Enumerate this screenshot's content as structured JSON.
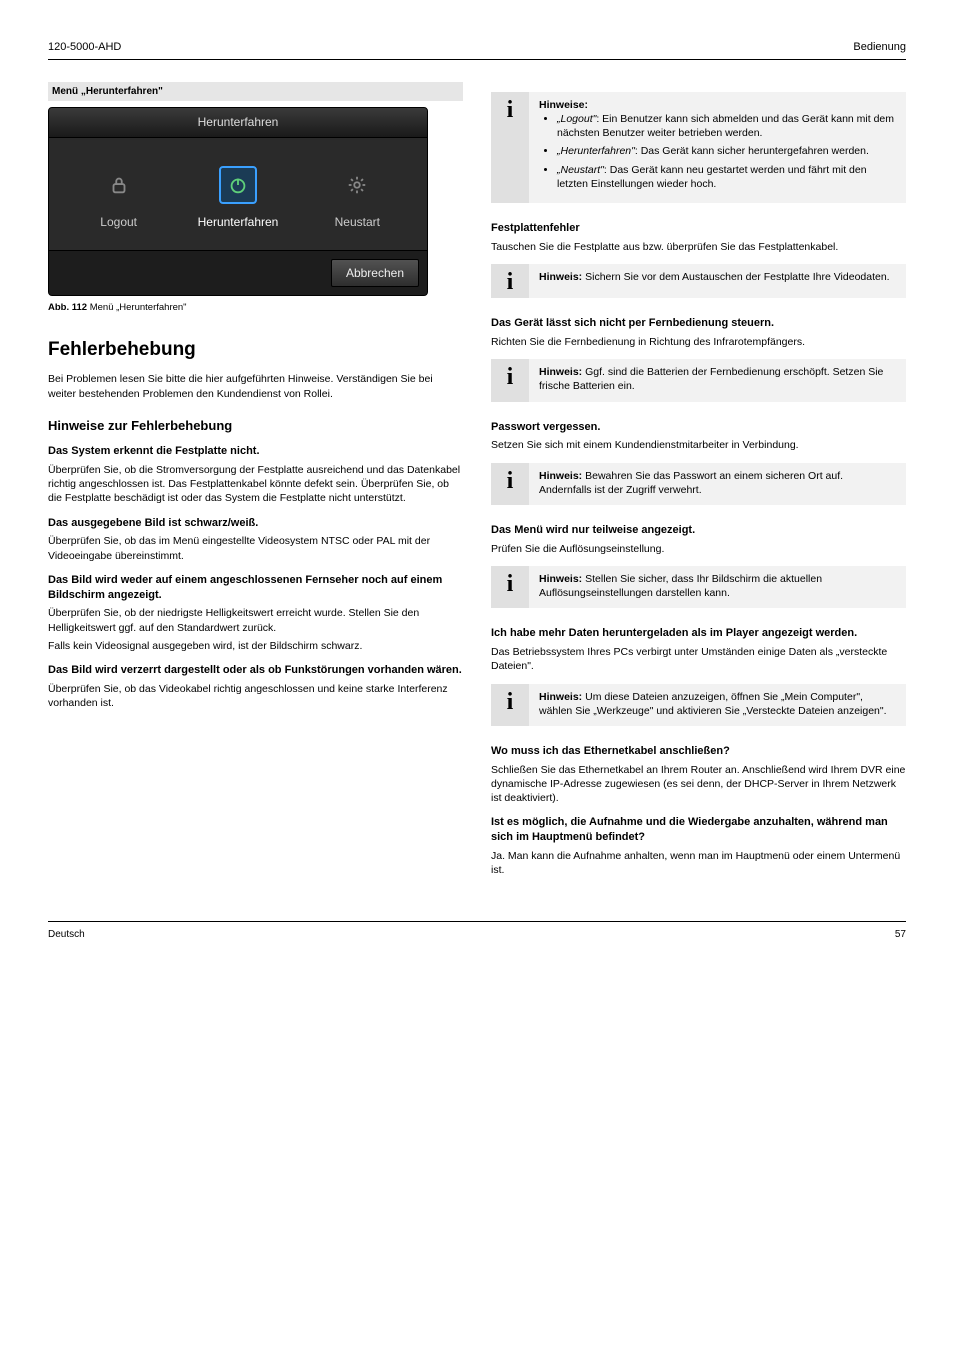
{
  "header": {
    "product": "120-5000-AHD",
    "section_title": "Bedienung"
  },
  "figure": {
    "label_bar": "Menü „Herunterfahren\"",
    "dialog_title": "Herunterfahren",
    "items": {
      "logout": "Logout",
      "shutdown": "Herunterfahren",
      "restart": "Neustart"
    },
    "cancel": "Abbrechen",
    "caption_bold": "Abb. 112",
    "caption_text": " Menü „Herunterfahren\""
  },
  "left": {
    "h1": "Fehlerbehebung",
    "p1": "Bei Problemen lesen Sie bitte die hier aufgeführten Hinweise. Verständigen Sie bei weiter bestehenden Problemen den Kundendienst von Rollei.",
    "h2": "Hinweise zur Fehlerbehebung",
    "q1_h": "Das System erkennt die Festplatte nicht.",
    "q1_p": "Überprüfen Sie, ob die Stromversorgung der Festplatte ausreichend und das Datenkabel richtig angeschlossen ist. Das Festplattenkabel könnte defekt sein. Überprüfen Sie, ob die Festplatte beschädigt ist oder das System die Festplatte nicht unterstützt.",
    "q2_h": "Das ausgegebene Bild ist schwarz/weiß.",
    "q2_p": "Überprüfen Sie, ob das im Menü eingestellte Videosystem NTSC oder PAL mit der Videoeingabe übereinstimmt.",
    "q3_h": "Das Bild wird weder auf einem angeschlossenen Fernseher noch auf einem Bildschirm angezeigt.",
    "q3_p_a": "Überprüfen Sie, ob der niedrigste Helligkeitswert erreicht wurde. Stellen Sie den Helligkeitswert ggf. auf den Standardwert zurück.",
    "q3_p_b": "Falls kein Videosignal ausgegeben wird, ist der Bildschirm schwarz.",
    "q4_h": "Das Bild wird verzerrt dargestellt oder als ob Funkstörungen vorhanden wären.",
    "q4_p": "Überprüfen Sie, ob das Videokabel richtig angeschlossen und keine starke Interferenz vorhanden ist."
  },
  "right": {
    "info_notes_title": "Hinweise:",
    "info_n1_a": "„Logout\"",
    "info_n1_b": ": Ein Benutzer kann sich abmelden und das Gerät kann mit dem nächsten Benutzer weiter betrieben werden.",
    "info_n2_a": "„Herunterfahren\"",
    "info_n2_b": ": Das Gerät kann sicher heruntergefahren werden.",
    "info_n3_a": "„Neustart\"",
    "info_n3_b": ": Das Gerät kann neu gestartet werden und fährt mit den letzten Einstellungen wieder hoch.",
    "q5_h": "Festplattenfehler",
    "q5_p1": "Tauschen Sie die Festplatte aus bzw. überprüfen Sie das Festplattenkabel.",
    "q5_info_title": "Hinweis:",
    "q5_info_body": "Sichern Sie vor dem Austauschen der Festplatte Ihre Videodaten.",
    "q6_h": "Das Gerät lässt sich nicht per Fernbedienung steuern.",
    "q6_p1": "Richten Sie die Fernbedienung in Richtung des Infrarotempfängers.",
    "q6_info_title": "Hinweis:",
    "q6_info_body": "Ggf. sind die Batterien der Fernbedienung erschöpft. Setzen Sie frische Batterien ein.",
    "q7_h": "Passwort vergessen.",
    "q7_p1": "Setzen Sie sich mit einem Kundendienstmitarbeiter in Verbindung.",
    "q7_info_title": "Hinweis:",
    "q7_info_body": "Bewahren Sie das Passwort an einem sicheren Ort auf. Andernfalls ist der Zugriff verwehrt.",
    "q8_h": "Das Menü wird nur teilweise angezeigt.",
    "q8_p1": "Prüfen Sie die Auflösungseinstellung.",
    "q8_info_title": "Hinweis:",
    "q8_info_body": "Stellen Sie sicher, dass Ihr Bildschirm die aktuellen Auflösungseinstellungen darstellen kann.",
    "q9_h": "Ich habe mehr Daten heruntergeladen als im Player angezeigt werden.",
    "q9_p1": "Das Betriebssystem Ihres PCs verbirgt unter Umständen einige Daten als „versteckte Dateien\".",
    "q9_info_title": "Hinweis:",
    "q9_info_body": "Um diese Dateien anzuzeigen, öffnen Sie „Mein Computer\", wählen Sie „Werkzeuge\" und aktivieren Sie „Versteckte Dateien anzeigen\".",
    "q10_h": "Wo muss ich das Ethernetkabel anschließen?",
    "q10_p": "Schließen Sie das Ethernetkabel an Ihrem Router an. Anschließend wird Ihrem DVR eine dynamische IP-Adresse zugewiesen (es sei denn, der DHCP-Server in Ihrem Netzwerk ist deaktiviert).",
    "q11_h": "Ist es möglich, die Aufnahme und die Wiedergabe anzuhalten, während man sich im Hauptmenü befindet?",
    "q11_p": "Ja. Man kann die Aufnahme anhalten, wenn man im Hauptmenü oder einem Untermenü ist."
  },
  "footer": {
    "page": "57",
    "left_small": "Deutsch"
  }
}
